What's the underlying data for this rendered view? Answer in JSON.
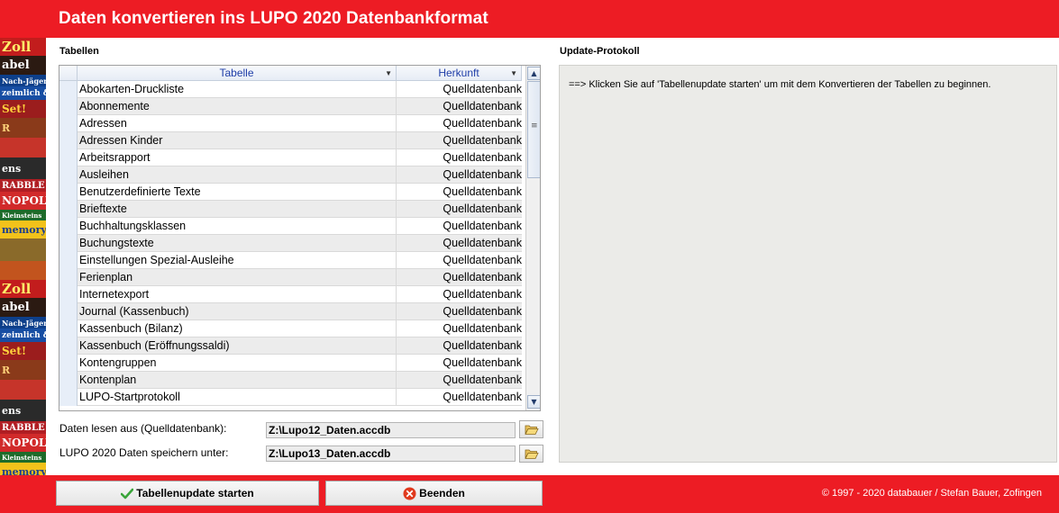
{
  "window": {
    "title": "Daten konvertieren ins LUPO 2020 Datenbankformat"
  },
  "side_strip": {
    "labels": [
      "Zoll",
      "abel",
      "Nach-Jäger-Raijen",
      "zeimlich & Co.",
      "Set!",
      "R",
      "",
      "ens",
      "RABBLE",
      "NOPOLY",
      "Kleinsteins",
      "memory",
      "",
      "",
      "Zoll",
      "abel",
      "Nach-Jäger-Raijen",
      "zeimlich & Co.",
      "Set!",
      "R",
      "",
      "ens",
      "RABBLE",
      "NOPOLY",
      "Kleinsteins",
      "memory"
    ]
  },
  "tables_section": {
    "label": "Tabellen",
    "columns": [
      "Tabelle",
      "Herkunft"
    ],
    "rows": [
      {
        "name": "Abokarten-Druckliste",
        "source": "Quelldatenbank"
      },
      {
        "name": "Abonnemente",
        "source": "Quelldatenbank"
      },
      {
        "name": "Adressen",
        "source": "Quelldatenbank"
      },
      {
        "name": "Adressen Kinder",
        "source": "Quelldatenbank"
      },
      {
        "name": "Arbeitsrapport",
        "source": "Quelldatenbank"
      },
      {
        "name": "Ausleihen",
        "source": "Quelldatenbank"
      },
      {
        "name": "Benutzerdefinierte Texte",
        "source": "Quelldatenbank"
      },
      {
        "name": "Brieftexte",
        "source": "Quelldatenbank"
      },
      {
        "name": "Buchhaltungsklassen",
        "source": "Quelldatenbank"
      },
      {
        "name": "Buchungstexte",
        "source": "Quelldatenbank"
      },
      {
        "name": "Einstellungen Spezial-Ausleihe",
        "source": "Quelldatenbank"
      },
      {
        "name": "Ferienplan",
        "source": "Quelldatenbank"
      },
      {
        "name": "Internetexport",
        "source": "Quelldatenbank"
      },
      {
        "name": "Journal (Kassenbuch)",
        "source": "Quelldatenbank"
      },
      {
        "name": "Kassenbuch (Bilanz)",
        "source": "Quelldatenbank"
      },
      {
        "name": "Kassenbuch (Eröffnungssaldi)",
        "source": "Quelldatenbank"
      },
      {
        "name": "Kontengruppen",
        "source": "Quelldatenbank"
      },
      {
        "name": "Kontenplan",
        "source": "Quelldatenbank"
      },
      {
        "name": "LUPO-Startprotokoll",
        "source": "Quelldatenbank"
      }
    ]
  },
  "source_db": {
    "label": "Daten lesen aus (Quelldatenbank):",
    "value": "Z:\\Lupo12_Daten.accdb"
  },
  "target_db": {
    "label": "LUPO 2020 Daten speichern unter:",
    "value": "Z:\\Lupo13_Daten.accdb"
  },
  "log_section": {
    "label": "Update-Protokoll",
    "message": "==>   Klicken Sie auf 'Tabellenupdate starten' um mit dem Konvertieren der Tabellen zu beginnen."
  },
  "footer": {
    "start_label": "Tabellenupdate starten",
    "exit_label": "Beenden",
    "copyright": "© 1997 - 2020 databauer / Stefan Bauer, Zofingen"
  },
  "colors": {
    "brand_red": "#ed1c24",
    "header_text": "#1f3ea8"
  }
}
